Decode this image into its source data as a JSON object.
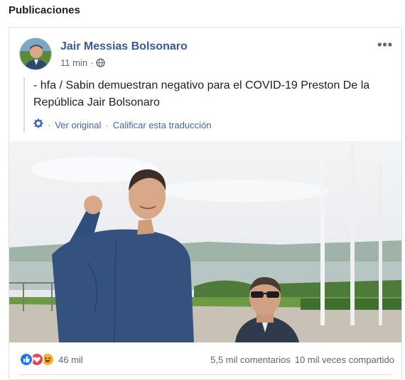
{
  "section": {
    "title": "Publicaciones"
  },
  "post": {
    "author": "Jair Messias Bolsonaro",
    "time": "11 min",
    "text": "- hfa / Sabin demuestran negativo para el COVID-19 Preston De la República Jair Bolsonaro",
    "more_label": "•••",
    "translation": {
      "see_original": "Ver original",
      "separator": "·",
      "rate": "Calificar esta traducción"
    }
  },
  "stats": {
    "reactions": "46 mil",
    "comments": "5,5 mil comentarios",
    "shares": "10 mil veces compartido"
  },
  "colors": {
    "link": "#385898",
    "like": "#1877f2",
    "love": "#f33e58",
    "haha": "#f7b125"
  },
  "icons": [
    "globe-icon",
    "gear-icon",
    "more-options-icon",
    "like-reaction-icon",
    "love-reaction-icon",
    "haha-reaction-icon"
  ]
}
